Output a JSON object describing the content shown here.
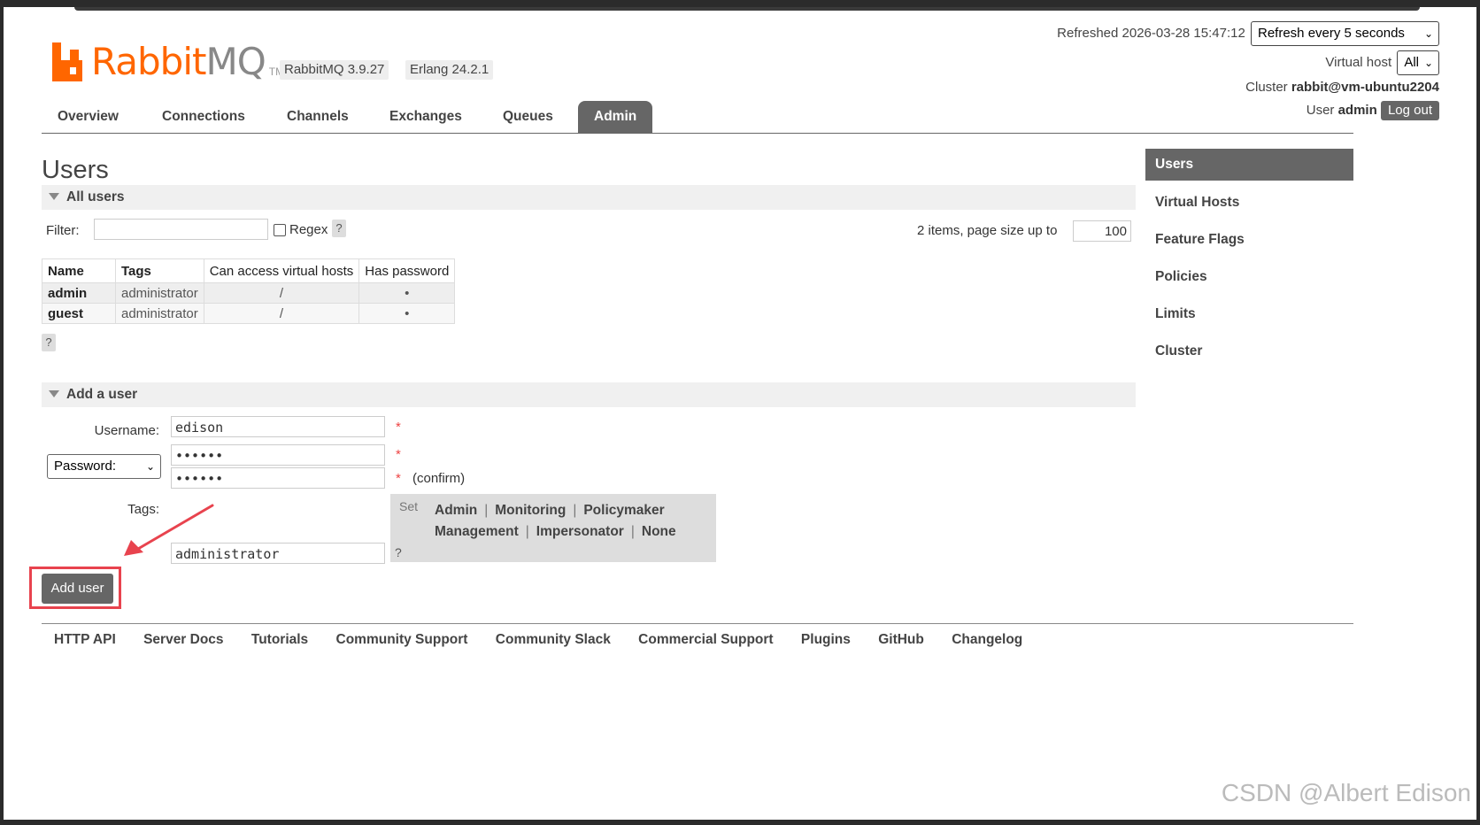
{
  "header": {
    "brand_left": "Rabbit",
    "brand_right": "MQ",
    "brand_tm": "TM",
    "version": "RabbitMQ 3.9.27",
    "erlang": "Erlang 24.2.1",
    "refreshed_label": "Refreshed 2026-03-28 15:47:12",
    "refresh_select": "Refresh every 5 seconds",
    "vhost_label": "Virtual host",
    "vhost_select": "All",
    "cluster_label": "Cluster",
    "cluster_value": "rabbit@vm-ubuntu2204",
    "user_label": "User",
    "user_value": "admin",
    "logout_label": "Log out"
  },
  "tabs": [
    "Overview",
    "Connections",
    "Channels",
    "Exchanges",
    "Queues",
    "Admin"
  ],
  "active_tab": "Admin",
  "sidebar": {
    "items": [
      "Users",
      "Virtual Hosts",
      "Feature Flags",
      "Policies",
      "Limits",
      "Cluster"
    ]
  },
  "page_title": "Users",
  "all_users": {
    "section_title": "All users",
    "filter_label": "Filter:",
    "filter_value": "",
    "regex_label": "Regex",
    "help": "?",
    "paging_text": "2 items, page size up to",
    "page_size": "100",
    "columns": [
      "Name",
      "Tags",
      "Can access virtual hosts",
      "Has password"
    ],
    "rows": [
      {
        "name": "admin",
        "tags": "administrator",
        "vhosts": "/",
        "has_password": "•"
      },
      {
        "name": "guest",
        "tags": "administrator",
        "vhosts": "/",
        "has_password": "•"
      }
    ]
  },
  "add_user": {
    "section_title": "Add a user",
    "username_label": "Username:",
    "username_value": "edison",
    "password_select": "Password:",
    "password_value": "••••••",
    "confirm_value": "••••••",
    "confirm_label": "(confirm)",
    "required_mark": "*",
    "tags_label": "Tags:",
    "tags_value": "administrator",
    "set_label": "Set",
    "tag_options": [
      "Admin",
      "Monitoring",
      "Policymaker",
      "Management",
      "Impersonator",
      "None"
    ],
    "separator": "|",
    "help": "?",
    "submit_label": "Add user"
  },
  "footer": {
    "links": [
      "HTTP API",
      "Server Docs",
      "Tutorials",
      "Community Support",
      "Community Slack",
      "Commercial Support",
      "Plugins",
      "GitHub",
      "Changelog"
    ]
  },
  "watermark": "CSDN @Albert Edison",
  "colors": {
    "brand_orange": "#ff6600",
    "tab_active": "#666666",
    "highlight_red": "#e8434e"
  }
}
